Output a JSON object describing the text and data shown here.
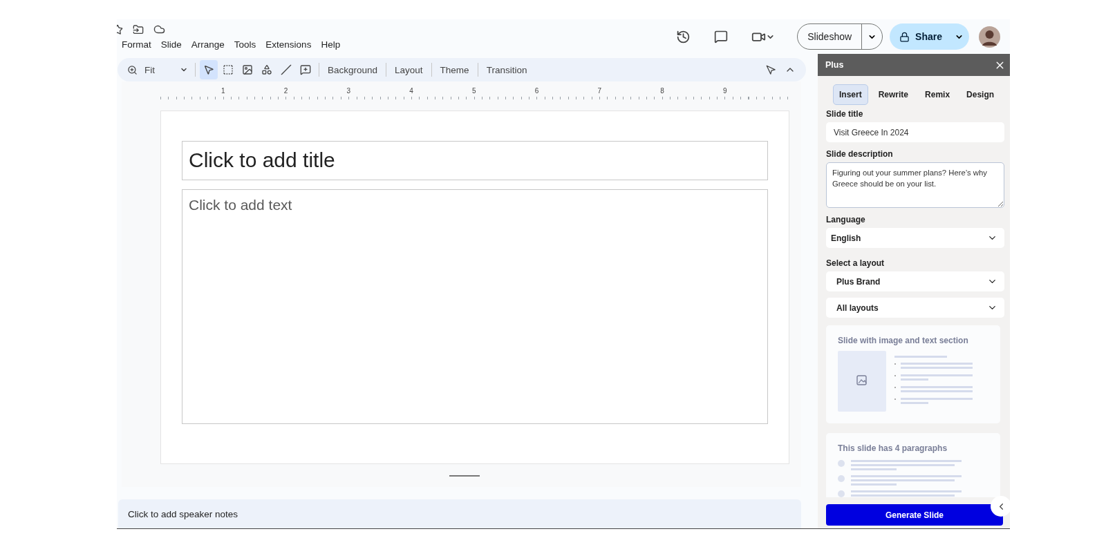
{
  "menu": [
    "Format",
    "Slide",
    "Arrange",
    "Tools",
    "Extensions",
    "Help"
  ],
  "header": {
    "slideshow": "Slideshow",
    "share": "Share"
  },
  "toolbar": {
    "zoom": "Fit",
    "tools": [
      {
        "kind": "select",
        "selected": true
      },
      {
        "kind": "textbox",
        "selected": false
      },
      {
        "kind": "image",
        "selected": false
      },
      {
        "kind": "shape",
        "selected": false
      },
      {
        "kind": "line",
        "selected": false
      },
      {
        "kind": "comment",
        "selected": false
      }
    ],
    "buttons": [
      "Background",
      "Layout",
      "Theme",
      "Transition"
    ]
  },
  "ruler": [
    "1",
    "2",
    "3",
    "4",
    "5",
    "6",
    "7",
    "8",
    "9"
  ],
  "slide": {
    "title_placeholder": "Click to add title",
    "body_placeholder": "Click to add text"
  },
  "notes": {
    "placeholder": "Click to add speaker notes"
  },
  "panel": {
    "title": "Plus",
    "tabs": [
      {
        "label": "Insert",
        "selected": true
      },
      {
        "label": "Rewrite",
        "selected": false
      },
      {
        "label": "Remix",
        "selected": false
      },
      {
        "label": "Design",
        "selected": false
      }
    ],
    "slide_title": {
      "label": "Slide title",
      "value": "Visit Greece In 2024"
    },
    "slide_description": {
      "label": "Slide description",
      "value": "Figuring out your summer plans? Here’s why Greece should be on your list."
    },
    "language": {
      "label": "Language",
      "value": "English"
    },
    "layout": {
      "label": "Select a layout",
      "value": "Plus Brand",
      "filter": "All layouts"
    },
    "layouts": [
      {
        "kind": "image_text",
        "title": "Slide with image and text section"
      },
      {
        "kind": "paragraphs",
        "title": "This slide has 4 paragraphs"
      }
    ],
    "generate": "Generate Slide"
  }
}
